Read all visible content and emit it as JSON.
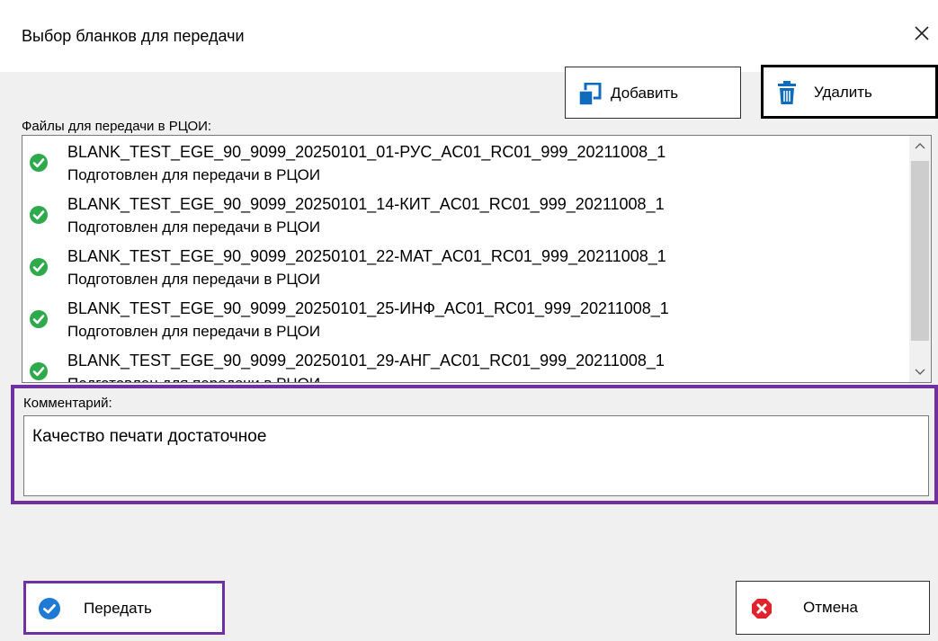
{
  "window": {
    "title": "Выбор бланков для передачи"
  },
  "toolbar": {
    "add_label": "Добавить",
    "delete_label": "Удалить"
  },
  "files": {
    "label": "Файлы для передачи в РЦОИ:",
    "items": [
      {
        "name": "BLANK_TEST_EGE_90_9099_20250101_01-РУС_AC01_RC01_999_20211008_1",
        "status": "Подготовлен для передачи в РЦОИ"
      },
      {
        "name": "BLANK_TEST_EGE_90_9099_20250101_14-КИТ_AC01_RC01_999_20211008_1",
        "status": "Подготовлен для передачи в РЦОИ"
      },
      {
        "name": "BLANK_TEST_EGE_90_9099_20250101_22-МАТ_AC01_RC01_999_20211008_1",
        "status": "Подготовлен для передачи в РЦОИ"
      },
      {
        "name": "BLANK_TEST_EGE_90_9099_20250101_25-ИНФ_AC01_RC01_999_20211008_1",
        "status": "Подготовлен для передачи в РЦОИ"
      },
      {
        "name": "BLANK_TEST_EGE_90_9099_20250101_29-АНГ_AC01_RC01_999_20211008_1",
        "status": "Подготовлен для передачи в РЦОИ"
      }
    ]
  },
  "comment": {
    "label": "Комментарий:",
    "value": "Качество печати достаточное"
  },
  "footer": {
    "send_label": "Передать",
    "cancel_label": "Отмена"
  },
  "colors": {
    "highlight": "#7030a0",
    "check_green": "#2ea94b",
    "send_blue": "#1f7ad6",
    "cancel_red": "#e0242e",
    "icon_blue": "#0f6cbd"
  }
}
